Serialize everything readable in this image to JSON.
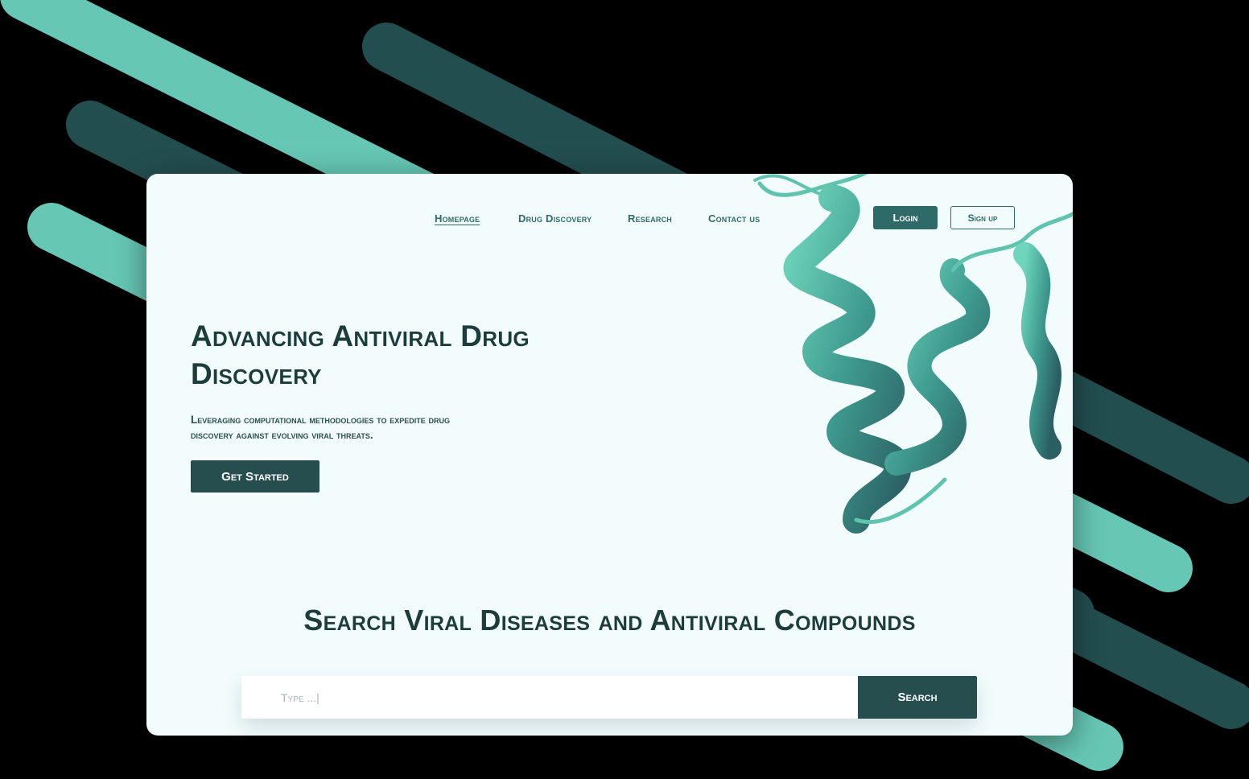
{
  "colors": {
    "page_background": "#000000",
    "card_background": "#f2fcfd",
    "primary_dark": "#264e4f",
    "nav_text": "#2e6b68",
    "heading_text": "#1d3c3c",
    "stripe_teal": "#66c7b5",
    "stripe_dark": "#234e50",
    "helix_teal": "#5fc4ae"
  },
  "nav": {
    "links": [
      {
        "label": "Homepage",
        "active": true
      },
      {
        "label": "Drug Discovery",
        "active": false
      },
      {
        "label": "Research",
        "active": false
      },
      {
        "label": "Contact us",
        "active": false
      }
    ],
    "login_label": "Login",
    "signup_label": "Sign up"
  },
  "hero": {
    "title_line1": "Advancing Antiviral Drug",
    "title_line2": "Discovery",
    "subtitle_line1": "Leveraging computational methodologies to expedite drug",
    "subtitle_line2": "discovery against evolving viral threats.",
    "cta_label": "Get Started",
    "illustration_icon": "protein-helix-illustration"
  },
  "search": {
    "title": "Search Viral Diseases and Antiviral Compounds",
    "placeholder": "Type ...|",
    "value": "",
    "button_label": "Search"
  }
}
